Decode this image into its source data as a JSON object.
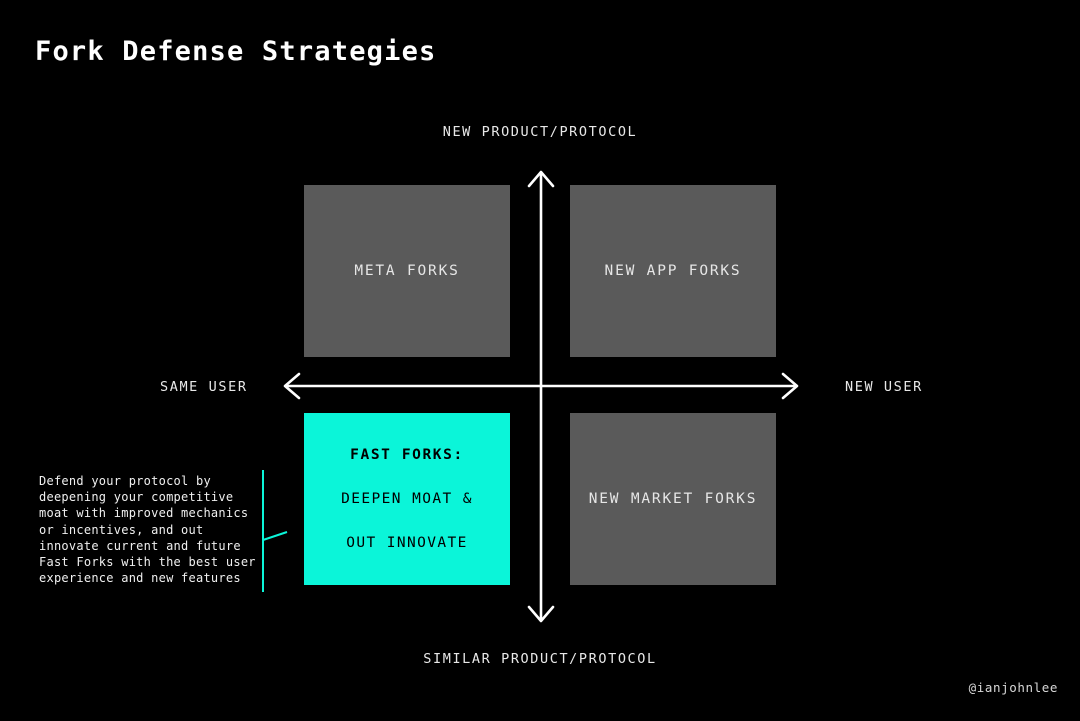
{
  "slide": {
    "title": "Fork Defense Strategies",
    "background_color": "#000000",
    "accent_color": "#0bf5d9",
    "box_gray": "#5a5a5a",
    "handle": "@ianjohnlee"
  },
  "axes": {
    "top_label": "NEW PRODUCT/PROTOCOL",
    "bottom_label": "SIMILAR PRODUCT/PROTOCOL",
    "left_label": "SAME USER",
    "right_label": "NEW USER"
  },
  "quadrants": {
    "top_left": {
      "label": "META FORKS",
      "fill": "#5a5a5a",
      "text_color": "#e6e6e6"
    },
    "top_right": {
      "label": "NEW APP FORKS",
      "fill": "#5a5a5a",
      "text_color": "#e6e6e6"
    },
    "bottom_left": {
      "heading": "FAST FORKS:",
      "line2": "DEEPEN MOAT &",
      "line3": "OUT INNOVATE",
      "fill": "#0bf5d9",
      "text_color": "#000000"
    },
    "bottom_right": {
      "label": "NEW MARKET FORKS",
      "fill": "#5a5a5a",
      "text_color": "#e6e6e6"
    }
  },
  "annotation": {
    "text": "Defend your protocol by deepening your competitive moat with improved mechanics or incentives, and out innovate current and future Fast Forks with the best user experience and new features"
  },
  "chart_data": {
    "type": "table",
    "title": "Fork Defense Strategies",
    "xlabel": "SAME USER ↔ NEW USER",
    "ylabel": "SIMILAR PRODUCT/PROTOCOL ↔ NEW PRODUCT/PROTOCOL",
    "x_axis_ends": [
      "SAME USER",
      "NEW USER"
    ],
    "y_axis_ends": [
      "SIMILAR PRODUCT/PROTOCOL",
      "NEW PRODUCT/PROTOCOL"
    ],
    "grid": false,
    "legend": "none",
    "quadrant_items": [
      {
        "quadrant": "top-left",
        "x": "same user",
        "y": "new product/protocol",
        "label": "META FORKS",
        "highlighted": false
      },
      {
        "quadrant": "top-right",
        "x": "new user",
        "y": "new product/protocol",
        "label": "NEW APP FORKS",
        "highlighted": false
      },
      {
        "quadrant": "bottom-left",
        "x": "same user",
        "y": "similar product/protocol",
        "label": "FAST FORKS: DEEPEN MOAT & OUT INNOVATE",
        "highlighted": true
      },
      {
        "quadrant": "bottom-right",
        "x": "new user",
        "y": "similar product/protocol",
        "label": "NEW MARKET FORKS",
        "highlighted": false
      }
    ]
  }
}
